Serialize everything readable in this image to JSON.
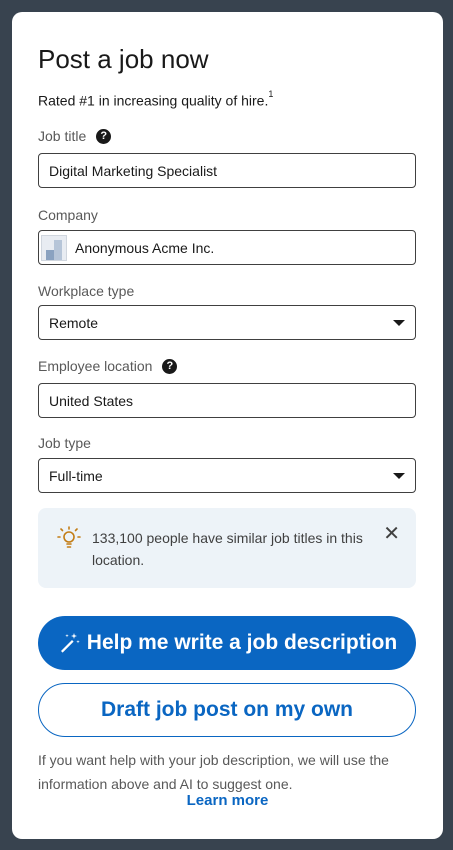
{
  "header": {
    "title": "Post a job now",
    "subtitle": "Rated #1 in increasing quality of hire.",
    "footnote_marker": "1"
  },
  "form": {
    "job_title": {
      "label": "Job title",
      "value": "Digital Marketing Specialist"
    },
    "company": {
      "label": "Company",
      "value": "Anonymous Acme Inc."
    },
    "workplace_type": {
      "label": "Workplace type",
      "value": "Remote"
    },
    "employee_location": {
      "label": "Employee location",
      "value": "United States"
    },
    "job_type": {
      "label": "Job type",
      "value": "Full-time"
    },
    "help_glyph": "?"
  },
  "tip": {
    "text": "133,100 people have similar job titles in this location.",
    "close_glyph": "✕",
    "icon": "lightbulb-icon"
  },
  "actions": {
    "primary_label": "Help me write a job description",
    "secondary_label": "Draft job post on my own"
  },
  "footer": {
    "note": "If you want help with your job description, we will use the information above and AI to suggest one.",
    "learn_more": "Learn more"
  },
  "colors": {
    "background": "#38434f",
    "primary": "#0a66c2",
    "tip_background": "#edf3f8",
    "bulb": "#c37d16"
  }
}
